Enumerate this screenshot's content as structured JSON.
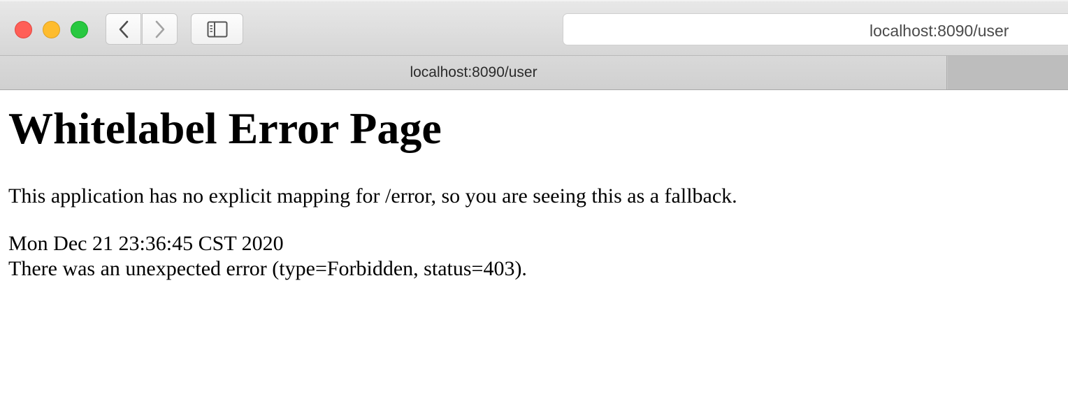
{
  "browser": {
    "address_bar": {
      "url": "localhost:8090/user"
    },
    "tab": {
      "title": "localhost:8090/user"
    },
    "buttons": {
      "back_icon": "chevron-left-icon",
      "forward_icon": "chevron-right-icon",
      "sidebar_icon": "sidebar-icon"
    },
    "window_controls": {
      "close_color": "#ff5f57",
      "minimize_color": "#febc2e",
      "maximize_color": "#28c840"
    }
  },
  "page": {
    "heading": "Whitelabel Error Page",
    "message": "This application has no explicit mapping for /error, so you are seeing this as a fallback.",
    "timestamp": "Mon Dec 21 23:36:45 CST 2020",
    "error_detail": "There was an unexpected error (type=Forbidden, status=403)."
  }
}
